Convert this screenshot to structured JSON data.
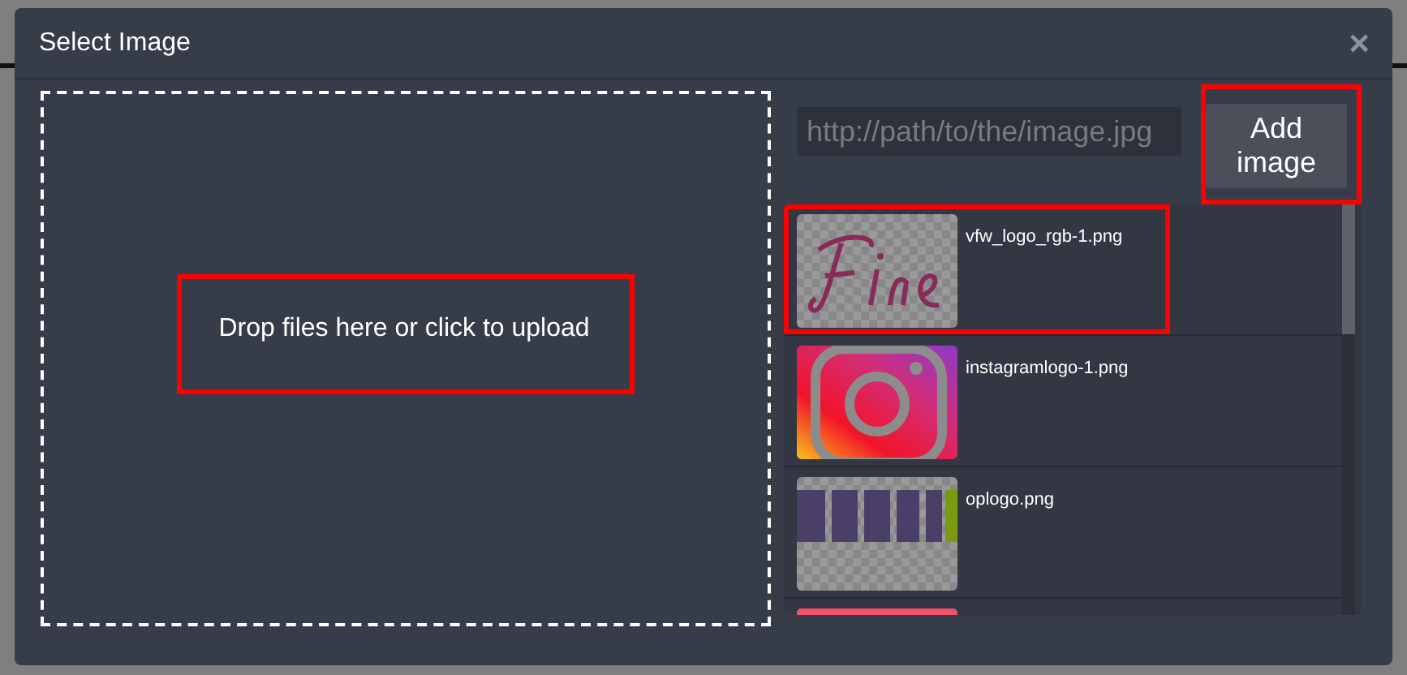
{
  "window": {
    "title": "Select Image",
    "close": "×"
  },
  "dropzone": {
    "text": "Drop files here or click to upload",
    "highlighted": true
  },
  "url_field": {
    "placeholder": "http://path/to/the/image.jpg"
  },
  "add_button": {
    "label": "Add image",
    "highlighted": true
  },
  "images": [
    {
      "kind": "script",
      "name": "vfw_logo_rgb-1.png",
      "highlighted": true
    },
    {
      "kind": "camera",
      "name": "instagramlogo-1.png",
      "highlighted": false
    },
    {
      "kind": "wordmark",
      "name": "oplogo.png",
      "highlighted": false
    },
    {
      "kind": "banner",
      "highlighted": false
    }
  ]
}
